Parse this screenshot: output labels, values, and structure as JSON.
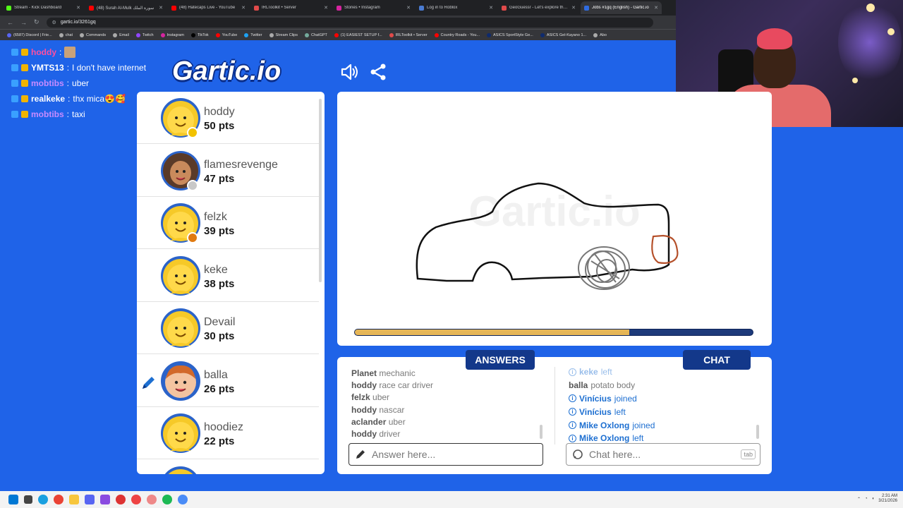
{
  "browser": {
    "tabs": [
      {
        "title": "Stream - Kick Dashboard",
        "color": "#53fc18",
        "active": false
      },
      {
        "title": "(48) Surah Al-Mulk سورة الملك",
        "color": "#ff0000",
        "active": false
      },
      {
        "title": "(48) Hatecaps Live - YouTube",
        "color": "#ff0000",
        "active": false
      },
      {
        "title": "IRLToolkit • Server",
        "color": "#e04a4a",
        "active": false
      },
      {
        "title": "Stories • Instagram",
        "color": "#d6249f",
        "active": false
      },
      {
        "title": "Log in to Roblox",
        "color": "#4a7bd1",
        "active": false
      },
      {
        "title": "GeoGuessr - Let's explore the w",
        "color": "#e04a4a",
        "active": false
      },
      {
        "title": "Jobs #1gq (English) - Gartic.io",
        "color": "#2f6be0",
        "active": true
      }
    ],
    "url": "gartic.io/3261gq",
    "bookmarks": [
      "(6587) Discord | Frie...",
      "chat",
      "Commands",
      "Email",
      "Twitch",
      "Instagram",
      "TikTok",
      "YouTube",
      "Twitter",
      "Stream Clips",
      "ChatGPT",
      "(1) EASIEST SETUP f...",
      "IRLToolkit • Server",
      "Country Roads - You...",
      "ASICS SportStyle Ge...",
      "ASICS Gel-Kayano 1...",
      "Abo"
    ]
  },
  "stream_chat": [
    {
      "user": "hoddy",
      "message": "",
      "user_color": "#ff4fa0"
    },
    {
      "user": "YMTS13",
      "message": "I don't have internet",
      "user_color": "#ffffff"
    },
    {
      "user": "mobtibs",
      "message": "uber",
      "user_color": "#c78bff"
    },
    {
      "user": "realkeke",
      "message": "thx mica😍🥰",
      "user_color": "#ffffff"
    },
    {
      "user": "mobtibs",
      "message": "taxi",
      "user_color": "#c78bff"
    }
  ],
  "logo": "Gartic.io",
  "players": [
    {
      "name": "hoddy",
      "points": "50 pts",
      "avatar": "smiley-yellow",
      "badge_color": "#f2c200",
      "drawing": false
    },
    {
      "name": "flamesrevenge",
      "points": "47 pts",
      "avatar": "girl-avatar",
      "badge_color": "#c8c8c8",
      "drawing": false
    },
    {
      "name": "felzk",
      "points": "39 pts",
      "avatar": "smiley-yellow",
      "badge_color": "#e07a10",
      "drawing": false
    },
    {
      "name": "keke",
      "points": "38 pts",
      "avatar": "smiley-yellow",
      "badge_color": "",
      "drawing": false
    },
    {
      "name": "Devail",
      "points": "30 pts",
      "avatar": "smiley-yellow",
      "badge_color": "",
      "drawing": false
    },
    {
      "name": "balla",
      "points": "26 pts",
      "avatar": "boy-avatar",
      "badge_color": "",
      "drawing": true
    },
    {
      "name": "hoodiez",
      "points": "22 pts",
      "avatar": "smiley-yellow",
      "badge_color": "",
      "drawing": false
    }
  ],
  "timer_progress": 0.69,
  "answers": {
    "tab_label": "ANSWERS",
    "items": [
      {
        "user": "Planet",
        "text": "mechanic"
      },
      {
        "user": "hoddy",
        "text": "race car driver"
      },
      {
        "user": "felzk",
        "text": "uber"
      },
      {
        "user": "hoddy",
        "text": "nascar"
      },
      {
        "user": "aclander",
        "text": "uber"
      },
      {
        "user": "hoddy",
        "text": "driver"
      }
    ],
    "placeholder": "Answer here..."
  },
  "chat": {
    "tab_label": "CHAT",
    "items": [
      {
        "user": "keke",
        "text": "left",
        "system": true
      },
      {
        "user": "balla",
        "text": "potato body",
        "system": false
      },
      {
        "user": "Vinícius",
        "text": "joined",
        "system": true
      },
      {
        "user": "Vinícius",
        "text": "left",
        "system": true
      },
      {
        "user": "Mike Oxlong",
        "text": "joined",
        "system": true
      },
      {
        "user": "Mike Oxlong",
        "text": "left",
        "system": true
      }
    ],
    "placeholder": "Chat here...",
    "tab_key": "tab"
  },
  "taskbar": {
    "time": "2:31 AM",
    "date": "3/21/2026"
  }
}
